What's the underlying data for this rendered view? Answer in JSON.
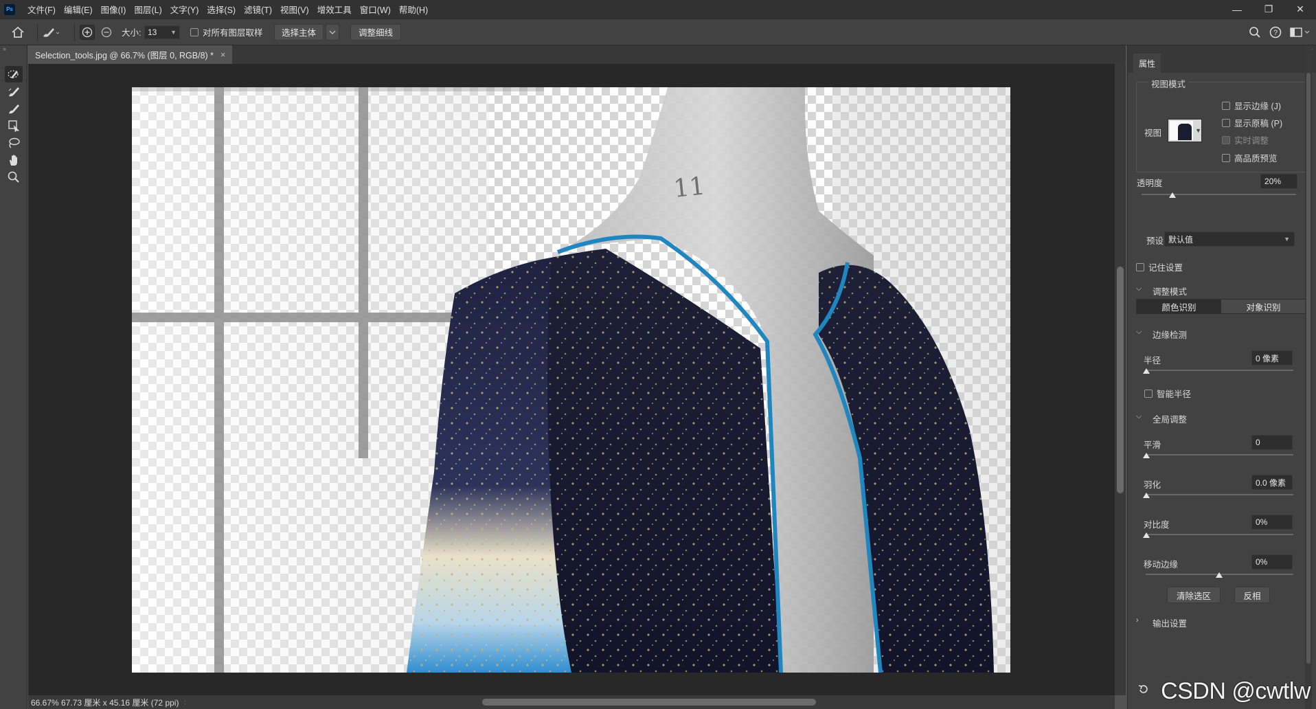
{
  "menubar": {
    "app_logo": "Ps",
    "items": [
      "文件(F)",
      "编辑(E)",
      "图像(I)",
      "图层(L)",
      "文字(Y)",
      "选择(S)",
      "滤镜(T)",
      "视图(V)",
      "增效工具",
      "窗口(W)",
      "帮助(H)"
    ],
    "window_controls": [
      "—",
      "❐",
      "✕"
    ]
  },
  "options": {
    "size_label": "大小:",
    "size_value": "13",
    "sample_all_layers": "对所有图层取样",
    "select_subject": "选择主体",
    "refine_hair": "调整细线"
  },
  "document": {
    "tab_title": "Selection_tools.jpg @ 66.7% (图层 0, RGB/8) *",
    "status": "66.67%  67.73 厘米 x 45.16 厘米 (72 ppi)"
  },
  "properties": {
    "tab": "属性",
    "view_mode_title": "视图模式",
    "view_label": "视图",
    "show_edge": "显示边缘 (J)",
    "show_original": "显示原稿 (P)",
    "realtime_refine": "实时调整",
    "hq_preview": "高品质预览",
    "opacity_label": "透明度",
    "opacity_value": "20%",
    "opacity_level": 0.2,
    "preset_label": "预设",
    "preset_value": "默认值",
    "remember_settings": "记住设置",
    "refine_mode_title": "调整模式",
    "color_aware": "颜色识别",
    "object_aware": "对象识别",
    "edge_detection_title": "边缘检测",
    "radius_label": "半径",
    "radius_value": "0 像素",
    "smart_radius": "智能半径",
    "global_refine_title": "全局调整",
    "smooth_label": "平滑",
    "smooth_value": "0",
    "feather_label": "羽化",
    "feather_value": "0.0 像素",
    "contrast_label": "对比度",
    "contrast_value": "0%",
    "shift_edge_label": "移动边缘",
    "shift_edge_value": "0%",
    "clear_selection": "清除选区",
    "invert": "反相",
    "output_settings_title": "输出设置",
    "watermark": "CSDN @cwtlw"
  },
  "colors": {
    "accent_edge": "#1f86c0",
    "ui_dark": "#323232",
    "ui_mid": "#424242",
    "canvas_bg": "#282828"
  },
  "icons": [
    "home-icon",
    "brush-tool-icon",
    "add-mode-icon",
    "subtract-mode-icon",
    "search-icon",
    "help-icon",
    "workspace-icon",
    "quick-selection-icon",
    "refine-edge-brush-icon",
    "brush-icon",
    "object-selection-icon",
    "lasso-icon",
    "hand-icon",
    "zoom-icon",
    "reset-icon"
  ]
}
